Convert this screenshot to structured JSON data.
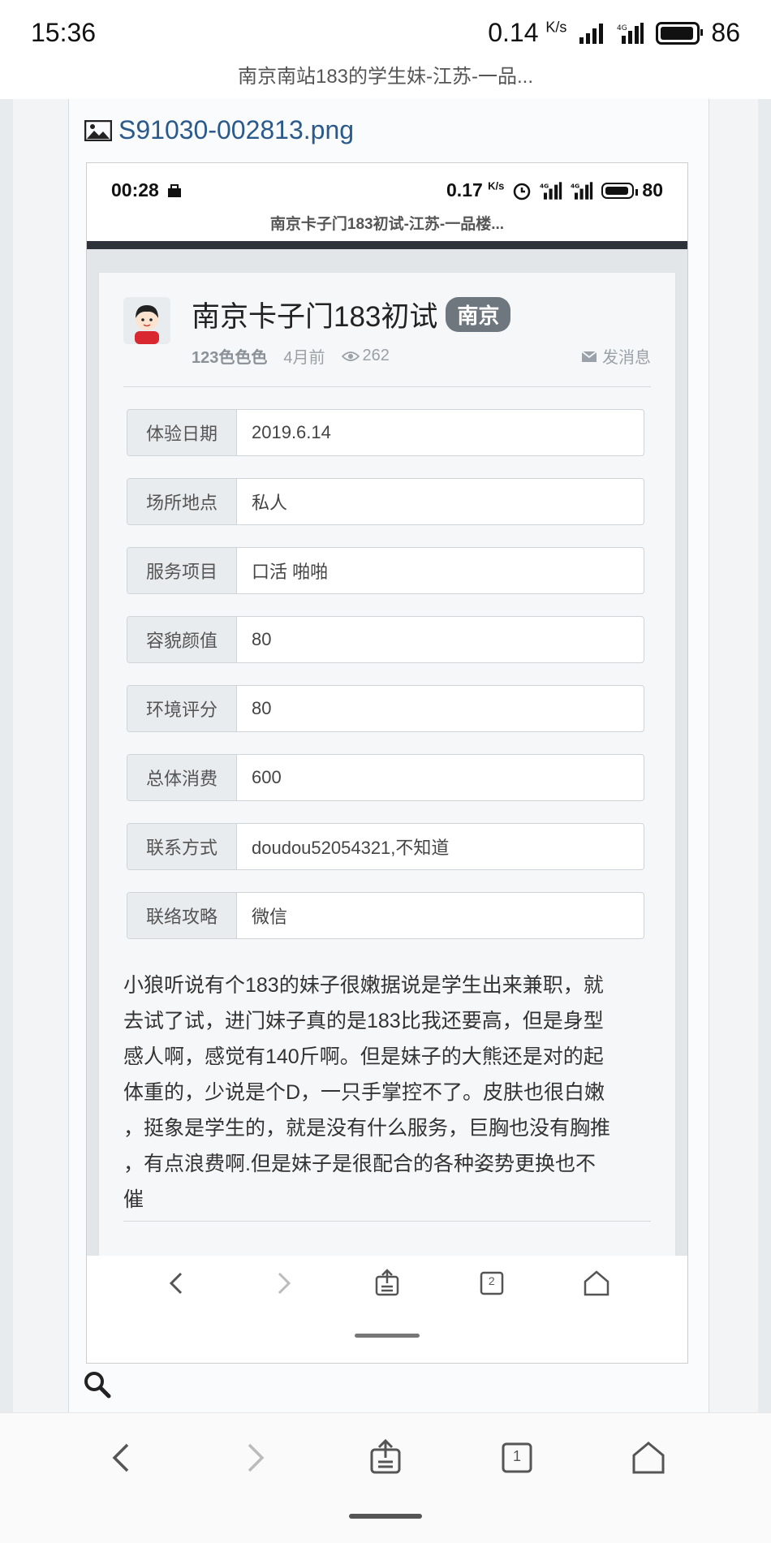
{
  "status_bar": {
    "time": "15:36",
    "speed": "0.14",
    "speed_unit": "K/s",
    "battery": "86"
  },
  "tab_title": "南京南站183的学生妹-江苏-一品...",
  "attachment": {
    "filename": "S91030-002813.png",
    "icon": "image-icon"
  },
  "inner_screenshot": {
    "status_bar": {
      "time": "00:28",
      "speed": "0.17",
      "speed_unit": "K/s",
      "battery": "80"
    },
    "tab_title": "南京卡子门183初试-江苏-一品楼...",
    "post": {
      "title": "南京卡子门183初试",
      "city_badge": "南京",
      "author": "123色色色",
      "time_ago": "4月前",
      "views": "262",
      "message_link": "发消息",
      "fields": [
        {
          "label": "体验日期",
          "value": "2019.6.14"
        },
        {
          "label": "场所地点",
          "value": "私人"
        },
        {
          "label": "服务项目",
          "value": "口活 啪啪"
        },
        {
          "label": "容貌颜值",
          "value": "80"
        },
        {
          "label": "环境评分",
          "value": "80"
        },
        {
          "label": "总体消费",
          "value": "600"
        },
        {
          "label": "联系方式",
          "value": "doudou52054321,不知道"
        },
        {
          "label": "联络攻略",
          "value": "微信"
        }
      ],
      "body_lines": [
        "小狼听说有个183的妹子很嫩据说是学生出来兼职，就",
        "去试了试，进门妹子真的是183比我还要高，但是身型",
        "感人啊，感觉有140斤啊。但是妹子的大熊还是对的起",
        "体重的，少说是个D，一只手掌控不了。皮肤也很白嫩",
        "，挺象是学生的，就是没有什么服务，巨胸也没有胸推",
        "，有点浪费啊.但是妹子是很配合的各种姿势更换也不",
        "催"
      ]
    },
    "nav": {
      "tabs_count": "2"
    }
  },
  "outer_nav": {
    "tabs_count": "1"
  },
  "colors": {
    "link": "#2a5a8c",
    "badge_bg": "#6e767e",
    "label_bg": "#e9ecef",
    "dark_bar": "#2d3339"
  }
}
